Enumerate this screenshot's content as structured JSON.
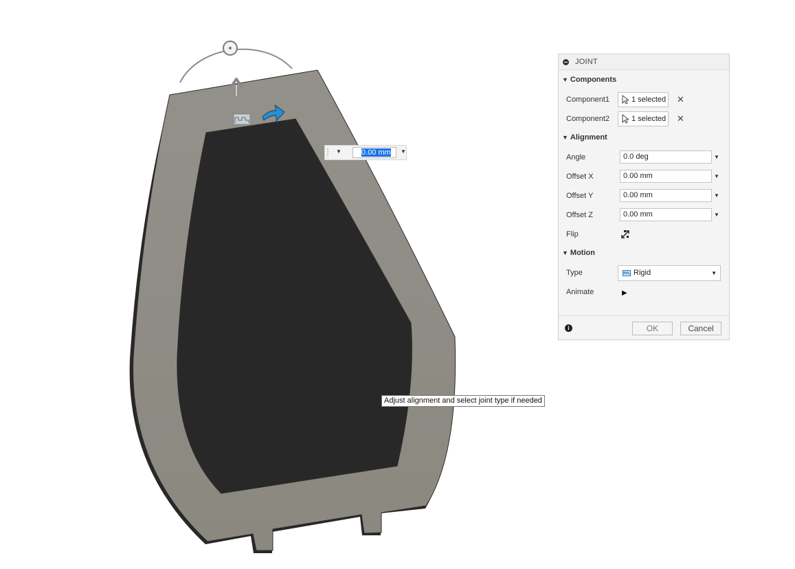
{
  "viewport": {
    "distance_value": "0.00 mm",
    "tooltip": "Adjust alignment and select joint type if needed"
  },
  "panel": {
    "title": "JOINT",
    "sections": {
      "components": "Components",
      "alignment": "Alignment",
      "motion": "Motion"
    },
    "component1": {
      "label": "Component1",
      "value": "1 selected"
    },
    "component2": {
      "label": "Component2",
      "value": "1 selected"
    },
    "angle": {
      "label": "Angle",
      "value": "0.0 deg"
    },
    "offset_x": {
      "label": "Offset X",
      "value": "0.00 mm"
    },
    "offset_y": {
      "label": "Offset Y",
      "value": "0.00 mm"
    },
    "offset_z": {
      "label": "Offset Z",
      "value": "0.00 mm"
    },
    "flip": {
      "label": "Flip"
    },
    "type": {
      "label": "Type",
      "value": "Rigid"
    },
    "animate": {
      "label": "Animate"
    },
    "ok_label": "OK",
    "cancel_label": "Cancel"
  },
  "colors": {
    "part_fill": "#8f8d86",
    "selection_highlight": "#1673e6",
    "arrow_blue": "#2a8fd0"
  }
}
